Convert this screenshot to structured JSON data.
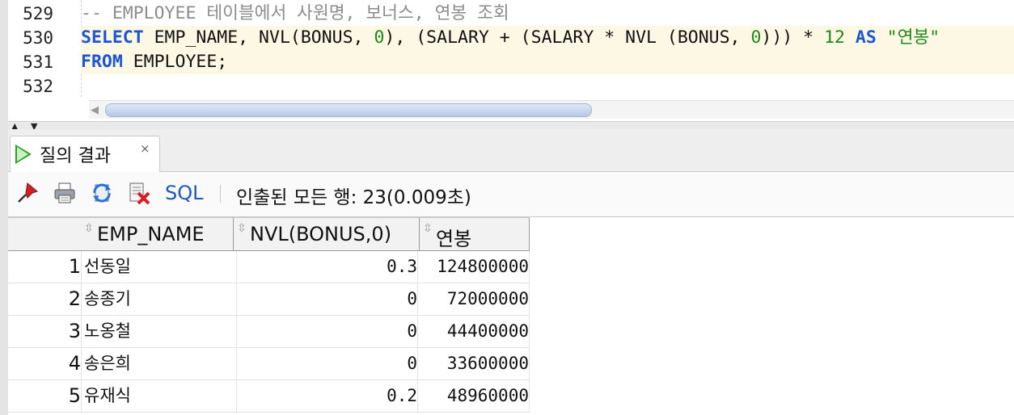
{
  "editor": {
    "line_numbers": [
      "529",
      "530",
      "531",
      "532"
    ],
    "line1_comment": "-- EMPLOYEE 테이블에서 사원명, 보너스, 연봉 조회",
    "line2": {
      "select": "SELECT",
      "part_a": " EMP_NAME, NVL(BONUS, ",
      "num_a": "0",
      "part_b": "), (SALARY + (SALARY * NVL (BONUS, ",
      "num_b": "0",
      "part_c": "))) * ",
      "num_c": "12",
      "part_d": " ",
      "as": "AS",
      "part_e": " ",
      "alias": "\"연봉\""
    },
    "line3": {
      "from": "FROM",
      "rest": " EMPLOYEE;"
    }
  },
  "results_tab": {
    "label": "질의 결과",
    "close": "×"
  },
  "toolbar": {
    "sql_label": "SQL",
    "status": "인출된 모든 행: 23(0.009초)"
  },
  "grid": {
    "columns": [
      "EMP_NAME",
      "NVL(BONUS,0)",
      "연봉"
    ],
    "rows": [
      {
        "num": "1",
        "name": "선동일",
        "bonus": "0.3",
        "salary": "124800000"
      },
      {
        "num": "2",
        "name": "송종기",
        "bonus": "0",
        "salary": "72000000"
      },
      {
        "num": "3",
        "name": "노옹철",
        "bonus": "0",
        "salary": "44400000"
      },
      {
        "num": "4",
        "name": "송은희",
        "bonus": "0",
        "salary": "33600000"
      },
      {
        "num": "5",
        "name": "유재식",
        "bonus": "0.2",
        "salary": "48960000"
      }
    ]
  },
  "icons": {
    "pin": "pin-icon",
    "print": "print-icon",
    "refresh": "refresh-icon",
    "delete": "delete-icon",
    "run": "run-icon"
  },
  "colors": {
    "keyword": "#1a55d6",
    "number": "#1d8a1d",
    "comment": "#8c8c8c",
    "highlight_line": "#fdf8e4"
  }
}
